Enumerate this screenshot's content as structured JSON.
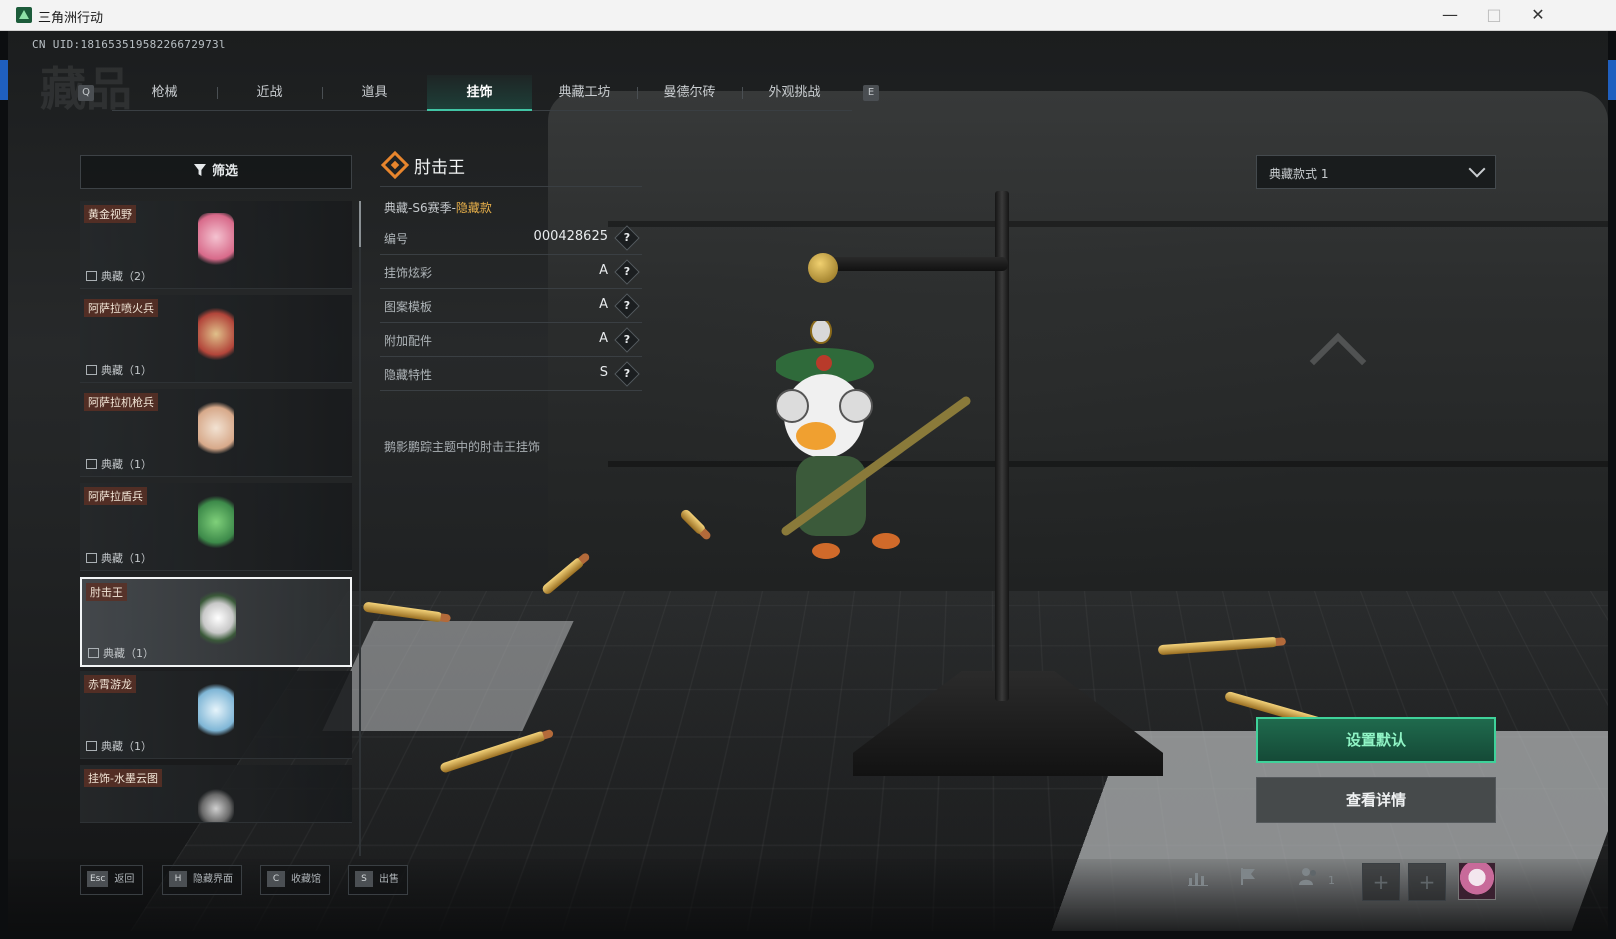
{
  "window": {
    "title": "三角洲行动",
    "controls": {
      "minimize": "—",
      "maximize": "□",
      "close": "✕"
    }
  },
  "header": {
    "uid": "CN UID:18165351958226672973l",
    "section_title": "藏品",
    "key_left": "Q",
    "key_right": "E",
    "tabs": [
      {
        "label": "枪械",
        "active": false
      },
      {
        "label": "近战",
        "active": false
      },
      {
        "label": "道具",
        "active": false
      },
      {
        "label": "挂饰",
        "active": true
      },
      {
        "label": "典藏工坊",
        "active": false
      },
      {
        "label": "曼德尔砖",
        "active": false
      },
      {
        "label": "外观挑战",
        "active": false
      }
    ]
  },
  "filter": {
    "label": "筛选"
  },
  "items": [
    {
      "name": "黄金视野",
      "meta": "典藏（2）",
      "color": "#d86a8a"
    },
    {
      "name": "阿萨拉喷火兵",
      "meta": "典藏（1）",
      "color": "#b2453a"
    },
    {
      "name": "阿萨拉机枪兵",
      "meta": "典藏（1）",
      "color": "#d7a98a"
    },
    {
      "name": "阿萨拉盾兵",
      "meta": "典藏（1）",
      "color": "#3d8a4a"
    },
    {
      "name": "肘击王",
      "meta": "典藏（1）",
      "color": "#eaeaea",
      "selected": true
    },
    {
      "name": "赤霄游龙",
      "meta": "典藏（1）",
      "color": "#7fb6d6"
    },
    {
      "name": "挂饰-水墨云图",
      "meta": "",
      "color": "#9a9a9a"
    }
  ],
  "detail": {
    "name": "肘击王",
    "season_prefix": "典藏-S6赛季-",
    "season_highlight": "隐藏款",
    "properties": [
      {
        "key": "编号",
        "value": "000428625"
      },
      {
        "key": "挂饰炫彩",
        "value": "A"
      },
      {
        "key": "图案模板",
        "value": "A"
      },
      {
        "key": "附加配件",
        "value": "A"
      },
      {
        "key": "隐藏特性",
        "value": "S"
      }
    ],
    "help_glyph": "?",
    "description": "鹅影鹏踪主题中的肘击王挂饰"
  },
  "style_select": {
    "value": "典藏款式 1"
  },
  "actions": {
    "set_default": "设置默认",
    "view_details": "查看详情"
  },
  "bottom_hints": [
    {
      "key": "Esc",
      "label": "返回"
    },
    {
      "key": "H",
      "label": "隐藏界面"
    },
    {
      "key": "C",
      "label": "收藏馆"
    },
    {
      "key": "S",
      "label": "出售"
    }
  ],
  "tray": {
    "stats_icon": "bar-chart-icon",
    "flag_icon": "flag-icon",
    "friends_icon": "friends-icon",
    "friend_count": "1",
    "slot_plus": "+"
  },
  "colors": {
    "accent_green": "#3fd29a",
    "tab_active": "#42c5a5",
    "detail_diamond": "#e7852d",
    "hidden_highlight": "#e8b04a"
  }
}
